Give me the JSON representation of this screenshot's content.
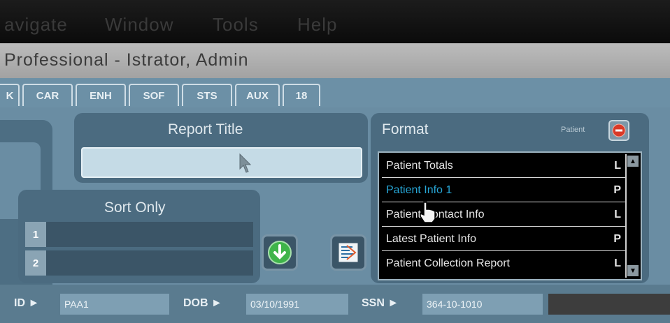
{
  "menubar": {
    "items": [
      "avigate",
      "Window",
      "Tools",
      "Help"
    ]
  },
  "titlebar": {
    "title": "Professional - Istrator, Admin"
  },
  "tabs": [
    "K",
    "CAR",
    "ENH",
    "SOF",
    "STS",
    "AUX",
    "18"
  ],
  "report_title": {
    "label": "Report Title",
    "value": ""
  },
  "format": {
    "label": "Format",
    "patient_label": "Patient",
    "items": [
      {
        "name": "Patient Totals",
        "code": "L"
      },
      {
        "name": "Patient Info 1",
        "code": "P"
      },
      {
        "name": "Patient Contact Info",
        "code": "L"
      },
      {
        "name": "Latest Patient Info",
        "code": "P"
      },
      {
        "name": "Patient Collection Report",
        "code": "L"
      }
    ],
    "selected_index": 1
  },
  "sort_only": {
    "label": "Sort Only",
    "rows": [
      "1",
      "2"
    ]
  },
  "status": {
    "id_label": "ID ►",
    "id_value": "PAA1",
    "dob_label": "DOB ►",
    "dob_value": "03/10/1991",
    "ssn_label": "SSN ►",
    "ssn_value": "364-10-1010"
  },
  "colors": {
    "selected_text": "#27a6d6",
    "green_button": "#3fb44a",
    "red_button": "#d93a28"
  }
}
